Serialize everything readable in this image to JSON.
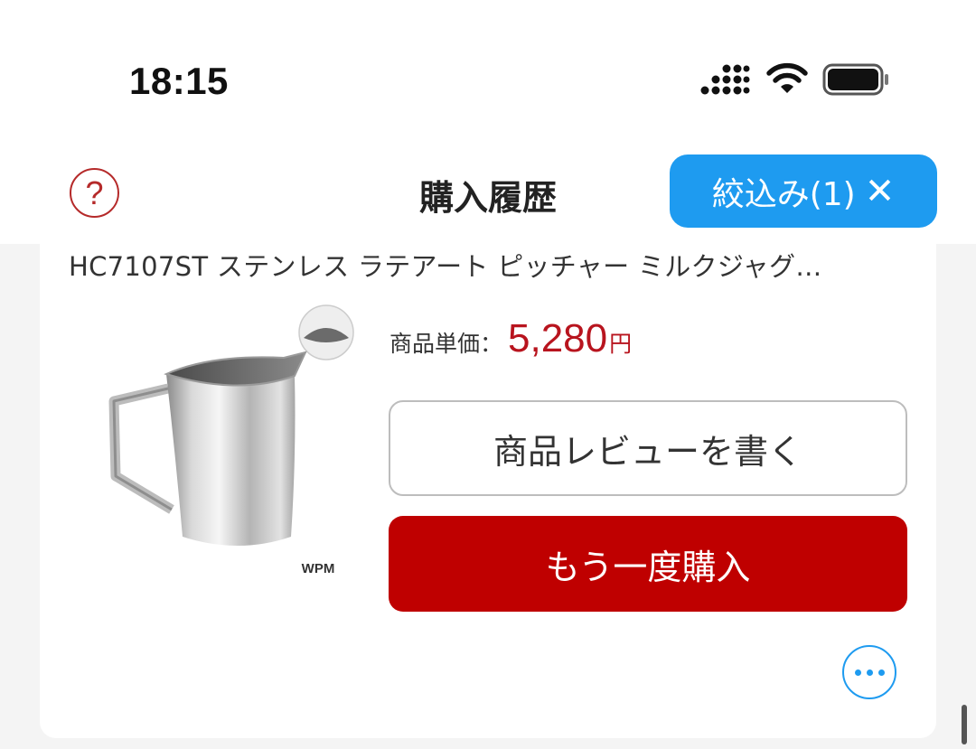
{
  "status_bar": {
    "time": "18:15",
    "icons": [
      "cellular-signal-icon",
      "wifi-icon",
      "battery-icon"
    ]
  },
  "header": {
    "help_icon_glyph": "?",
    "title": "購入履歴",
    "filter_chip": {
      "label": "絞込み(1)",
      "clear_glyph": "✕"
    }
  },
  "product": {
    "title": "HC7107ST ステンレス ラテアート ピッチャー ミルクジャグ…",
    "image_alt": "stainless milk pitcher",
    "image_brand": "WPM",
    "price_label": "商品単価：",
    "price_value": "5,280",
    "price_unit": "円",
    "review_button": "商品レビューを書く",
    "rebuy_button": "もう一度購入"
  },
  "colors": {
    "accent_blue": "#1e9bf0",
    "brand_red": "#bf0000",
    "price_red": "#b8141e"
  }
}
